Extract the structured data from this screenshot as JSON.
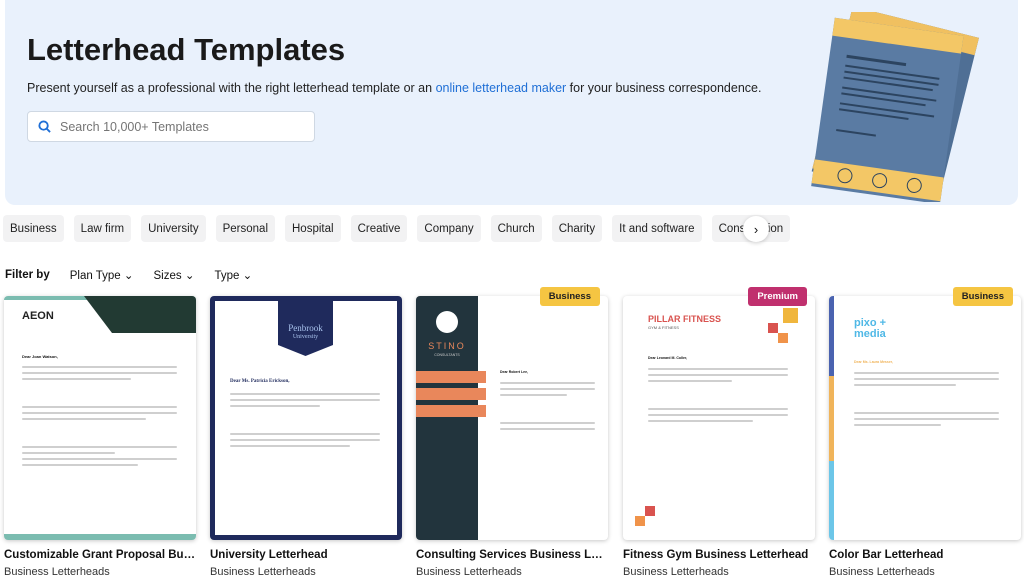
{
  "hero": {
    "title": "Letterhead Templates",
    "subtitle_before": "Present yourself as a professional with the right letterhead template or an ",
    "subtitle_link": "online letterhead maker",
    "subtitle_after": " for your business correspondence.",
    "search_placeholder": "Search 10,000+ Templates"
  },
  "categories": [
    "Business",
    "Law firm",
    "University",
    "Personal",
    "Hospital",
    "Creative",
    "Company",
    "Church",
    "Charity",
    "It and software",
    "Construction"
  ],
  "filters": {
    "label": "Filter by",
    "items": [
      "Plan Type",
      "Sizes",
      "Type"
    ]
  },
  "colors": {
    "hero_bg": "#e9f1fc",
    "link": "#1f6fd6",
    "business_badge": "#f5c542",
    "premium_badge": "#c0306e"
  },
  "cards": [
    {
      "title": "Customizable Grant Proposal Busi...",
      "category": "Business Letterheads",
      "badge": "",
      "logo": "AEON",
      "greeting": "Dear Joan Watson,"
    },
    {
      "title": "University Letterhead",
      "category": "Business Letterheads",
      "badge": "",
      "logo": "Penbrook",
      "logo_sub": "University",
      "greeting": "Dear Ms. Patricia Erickson,"
    },
    {
      "title": "Consulting Services Business Lett...",
      "category": "Business Letterheads",
      "badge": "Business",
      "logo": "STINO",
      "logo_sub": "CONSULTANTS",
      "greeting": "Dear Robert Lee,"
    },
    {
      "title": "Fitness Gym Business Letterhead",
      "category": "Business Letterheads",
      "badge": "Premium",
      "logo": "PILLAR FITNESS",
      "logo_sub": "GYM & FITNESS",
      "greeting": "Dear Leonard M. Coller,"
    },
    {
      "title": "Color Bar Letterhead",
      "category": "Business Letterheads",
      "badge": "Business",
      "logo": "pixo + media",
      "greeting": "Dear Ms. Laura Messer,"
    }
  ]
}
